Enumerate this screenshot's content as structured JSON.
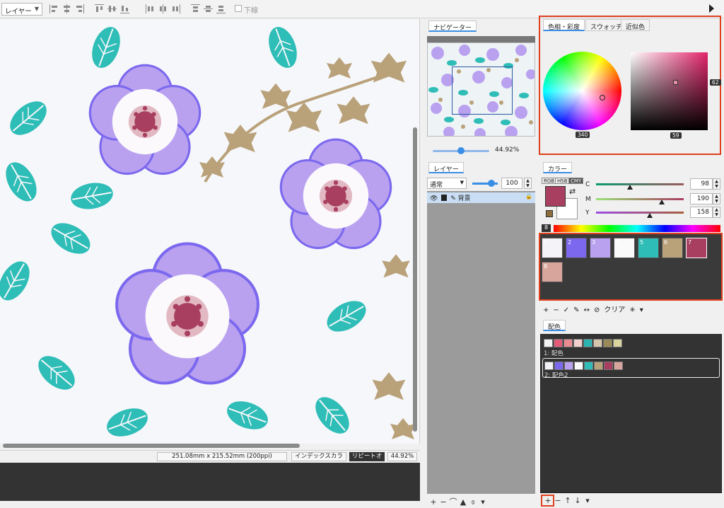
{
  "toolbar": {
    "layer_select": "レイヤー",
    "underline_label": "下線"
  },
  "status": {
    "dimensions": "251.08mm x 215.52mm (200ppi)",
    "index_color": "インデックスカラー",
    "repeat": "リピートオン",
    "zoom": "44.92%"
  },
  "navigator": {
    "tab": "ナビゲーター",
    "zoom": "44.92%"
  },
  "layers": {
    "tab": "レイヤー",
    "blend_mode": "通常",
    "opacity": "100",
    "layer_name": "背景"
  },
  "color_picker": {
    "tabs": [
      "色相・彩度",
      "スウォッチ",
      "近似色"
    ],
    "hue_value": "340",
    "saturation_value": "59",
    "brightness_value": "62"
  },
  "color": {
    "tab": "カラー",
    "modes": [
      "RGB",
      "HSB",
      "CMY"
    ],
    "sliders": [
      {
        "label": "C",
        "value": "98"
      },
      {
        "label": "M",
        "value": "190"
      },
      {
        "label": "Y",
        "value": "158"
      }
    ],
    "spectrum_number": "8"
  },
  "swatches": {
    "items": [
      {
        "num": "1",
        "color": "#f3f3f8"
      },
      {
        "num": "2",
        "color": "#7b68ee"
      },
      {
        "num": "3",
        "color": "#b9a1f0"
      },
      {
        "num": "4",
        "color": "#fafafa"
      },
      {
        "num": "5",
        "color": "#2ebdb7"
      },
      {
        "num": "6",
        "color": "#b9a17a"
      },
      {
        "num": "7",
        "color": "#a83f60"
      },
      {
        "num": "8",
        "color": "#d8a59c"
      }
    ],
    "clear_label": "クリア"
  },
  "scheme": {
    "tab": "配色",
    "items": [
      {
        "label": "1: 配色",
        "colors": [
          "#f2f2f2",
          "#e35b78",
          "#e88a8f",
          "#f0d0cf",
          "#2bb5b2",
          "#d6c6ad",
          "#9a8a5a",
          "#d8d4a0"
        ]
      },
      {
        "label": "2: 配色2",
        "colors": [
          "#f2f2f8",
          "#7b68ee",
          "#b9a1f0",
          "#fafafa",
          "#2ebdb7",
          "#b9a17a",
          "#a83f60",
          "#d8a59c"
        ]
      }
    ]
  }
}
